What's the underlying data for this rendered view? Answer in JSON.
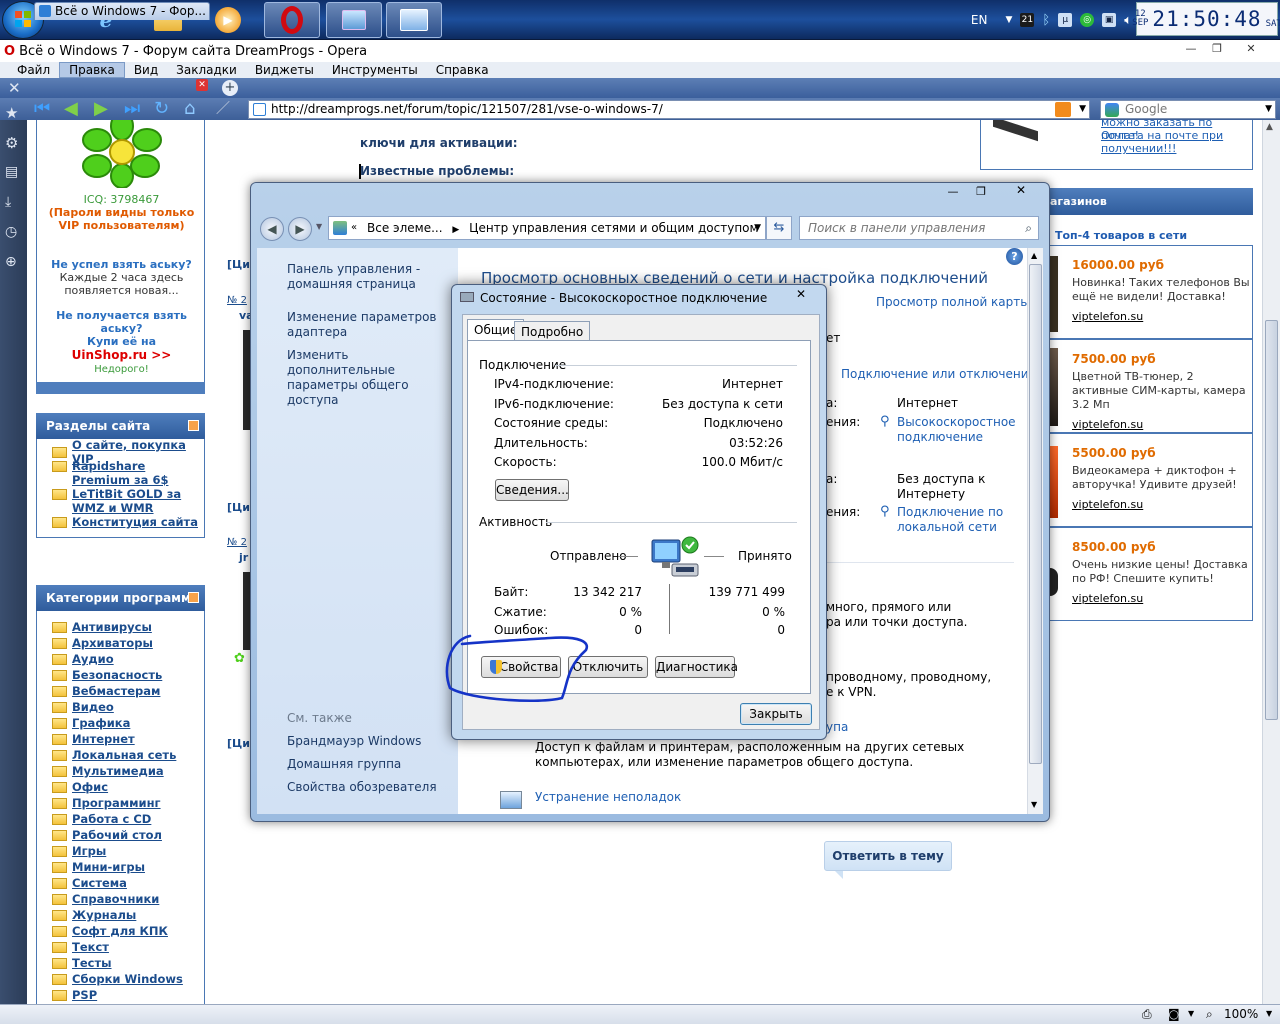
{
  "taskbar": {
    "lang": "EN",
    "clock_day": "12",
    "clock_month": "SEP",
    "clock_time": "21:50:48",
    "clock_weekday": "SAT",
    "tray_badge": "21"
  },
  "browser": {
    "window_title": "Всё о Windows 7 - Форум сайта DreamProgs - Opera",
    "menu": [
      "Файл",
      "Правка",
      "Вид",
      "Закладки",
      "Виджеты",
      "Инструменты",
      "Справка"
    ],
    "tab_title": "Всё о Windows 7 - Фор...",
    "url": "http://dreamprogs.net/forum/topic/121507/281/vse-o-windows-7/",
    "search_placeholder": "Google",
    "zoom": "100%"
  },
  "page": {
    "icq_number": "ICQ: 3798467",
    "icq_note": "(Пароли видны только VIP пользователям)",
    "icq_q1": "Не успел взять аську?",
    "icq_t1": "Каждые 2 часа здесь появляется новая...",
    "icq_q2": "Не получается взять аську?",
    "icq_t2": "Купи её на",
    "uinshop": "UinShop.ru >>",
    "cheap": "Недорого!",
    "post_keys": "ключи для активации:",
    "post_known": "Известные проблемы:",
    "sections_title": "Разделы сайта",
    "sections": [
      "О сайте, покупка VIP",
      "Rapidshare Premium за 6$",
      "LeTitBit GOLD за WMZ и WMR",
      "Конституция сайта"
    ],
    "categories_title": "Категории программ",
    "categories": [
      "Антивирусы",
      "Архиваторы",
      "Аудио",
      "Безопасность",
      "Вебмастерам",
      "Видео",
      "Графика",
      "Интернет",
      "Локальная сеть",
      "Мультимедиа",
      "Офис",
      "Программинг",
      "Работа с CD",
      "Рабочий стол",
      "Игры",
      "Мини-игры",
      "Система",
      "Справочники",
      "Журналы",
      "Софт для КПК",
      "Текст",
      "Тесты",
      "Сборки Windows",
      "PSP"
    ],
    "reply_button": "Ответить в тему",
    "top_promo": [
      "можно заказать по почте!",
      "Оплата на почте при получении!!!"
    ],
    "shops_title": "агазинов",
    "top4": "Топ-4 товаров в сети",
    "ads": [
      {
        "price": "16000.00 руб",
        "text": "Новинка! Таких телефонов Вы ещё не видели! Доставка!",
        "link": "viptelefon.su"
      },
      {
        "price": "7500.00 руб",
        "text": "Цветной ТВ-тюнер, 2 активные СИМ-карты, камера 3.2 Мп",
        "link": "viptelefon.su"
      },
      {
        "price": "5500.00 руб",
        "text": "Видеокамера + диктофон + авторучка! Удивите друзей!",
        "link": "viptelefon.su"
      },
      {
        "price": "8500.00 руб",
        "text": "Очень низкие цены! Доставка по РФ! Спешите купить!",
        "link": "viptelefon.su"
      }
    ],
    "quote_stubs": [
      "[Цит",
      "[Цит",
      "[Цит"
    ],
    "post_nums": [
      "№ 2",
      "№ 2"
    ],
    "author_stubs": [
      "va",
      "jr"
    ]
  },
  "control_panel": {
    "breadcrumb_prefix": "Все элеме...",
    "breadcrumb_current": "Центр управления сетями и общим доступом",
    "search_placeholder": "Поиск в панели управления",
    "side_links": [
      "Панель управления - домашняя страница",
      "Изменение параметров адаптера",
      "Изменить дополнительные параметры общего доступа"
    ],
    "see_also": "См. также",
    "see_also_links": [
      "Брандмауэр Windows",
      "Домашняя группа",
      "Свойства обозревателя"
    ],
    "heading": "Просмотр основных сведений о сети и настройка подключений",
    "full_map": "Просмотр полной карты",
    "connect_disconnect": "Подключение или отключение",
    "access_label": "Интернет",
    "conn_link1": "Высокоскоростное подключение",
    "access_label2": "Без доступа к Интернету",
    "conn_link2": "Подключение по локальной сети",
    "partial_a": "а:",
    "partial_b": "ения:",
    "partial_c": "а:",
    "partial_d": "ения:",
    "partial_e": "ет",
    "partial_text1": "много, прямого или",
    "partial_text2": "ра или точки доступа.",
    "partial_text3": "проводному, проводному,",
    "partial_text4": "е к VPN.",
    "partial_link": "упа",
    "share_desc": "Доступ к файлам и принтерам, расположенным на других сетевых компьютерах, или изменение параметров общего доступа.",
    "troubleshoot": "Устранение неполадок"
  },
  "dialog": {
    "title": "Состояние - Высокоскоростное подключение",
    "tabs": [
      "Общие",
      "Подробно"
    ],
    "section_connection": "Подключение",
    "rows": [
      {
        "label": "IPv4-подключение:",
        "value": "Интернет"
      },
      {
        "label": "IPv6-подключение:",
        "value": "Без доступа к сети"
      },
      {
        "label": "Состояние среды:",
        "value": "Подключено"
      },
      {
        "label": "Длительность:",
        "value": "03:52:26"
      },
      {
        "label": "Скорость:",
        "value": "100.0 Мбит/с"
      }
    ],
    "details_button": "Сведения...",
    "section_activity": "Активность",
    "sent": "Отправлено",
    "received": "Принято",
    "bytes_label": "Байт:",
    "bytes_sent": "13 342 217",
    "bytes_received": "139 771 499",
    "compression_label": "Сжатие:",
    "compression_sent": "0 %",
    "compression_received": "0 %",
    "errors_label": "Ошибок:",
    "errors_sent": "0",
    "errors_received": "0",
    "properties_button": "Свойства",
    "disconnect_button": "Отключить",
    "diagnose_button": "Диагностика",
    "close_button": "Закрыть"
  }
}
